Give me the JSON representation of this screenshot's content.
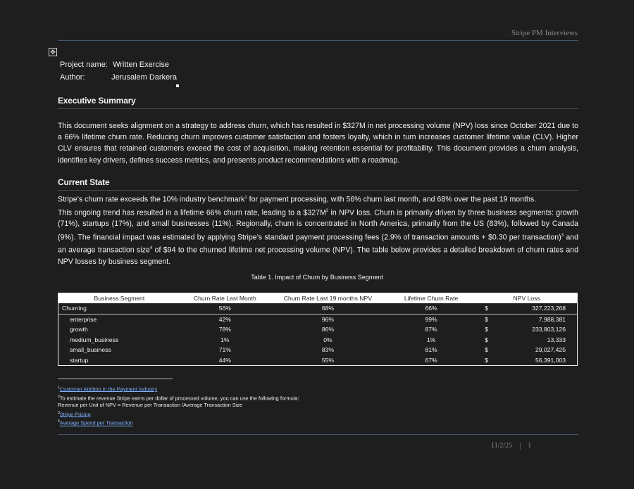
{
  "header": {
    "label": "Stripe PM Interviews"
  },
  "meta": {
    "project_label": "Project name:",
    "project_value": "Written Exercise",
    "author_label": "Author:",
    "author_value": "Jerusalem Darkera"
  },
  "sections": {
    "executive_summary": {
      "title": "Executive Summary",
      "body": "This document seeks alignment on a strategy to address churn, which has resulted in $327M in net processing volume (NPV) loss since October 2021 due to a 66% lifetime churn rate. Reducing churn improves customer satisfaction and fosters loyalty, which in turn increases customer lifetime value (CLV). Higher CLV ensures that retained customers exceed the cost of acquisition, making retention essential for profitability. This document provides a churn analysis, identifies key drivers, defines success metrics, and presents product recommendations with a roadmap."
    },
    "current_state": {
      "title": "Current State",
      "line1_a": "Stripe’s churn rate exceeds the 10% industry benchmark",
      "line1_sup": "1",
      "line1_b": " for payment processing, with 56% churn last month, and 68% over the past 19 months.",
      "body_a": "This ongoing trend has resulted in a lifetime 66% churn rate, leading to a $327M",
      "body_sup2": "2",
      "body_b": " in NPV loss. Churn is primarily driven by three business segments: growth (71%), startups (17%), and small businesses (11%). Regionally, churn is concentrated in North America, primarily from the US (83%), followed by Canada (9%). The financial impact was estimated by applying Stripe’s standard payment processing fees (2.9% of transaction amounts + $0.30 per transaction)",
      "body_sup3": "3",
      "body_c": " and an average transaction size",
      "body_sup4": "4",
      "body_d": " of $94 to the churned lifetime net processing volume (NPV). The table below provides a detailed breakdown of churn rates and NPV losses by business segment."
    }
  },
  "table": {
    "caption": "Table 1. Impact of Churn by Business Segment",
    "headers": [
      "Business Segment",
      "Churn Rate Last Month",
      "Churn Rate Last 19 months NPV",
      "Lifetime Churn Rate",
      "NPV Loss"
    ],
    "group": {
      "segment": "Churning",
      "last_month": "56%",
      "last_19": "68%",
      "lifetime": "66%",
      "currency": "$",
      "npv": "327,223,268"
    },
    "rows": [
      {
        "segment": "enterprise",
        "last_month": "42%",
        "last_19": "96%",
        "lifetime": "99%",
        "currency": "$",
        "npv": "7,988,381"
      },
      {
        "segment": "growth",
        "last_month": "78%",
        "last_19": "86%",
        "lifetime": "87%",
        "currency": "$",
        "npv": "233,803,126"
      },
      {
        "segment": "medium_business",
        "last_month": "1%",
        "last_19": "0%",
        "lifetime": "1%",
        "currency": "$",
        "npv": "13,333"
      },
      {
        "segment": "small_business",
        "last_month": "71%",
        "last_19": "83%",
        "lifetime": "81%",
        "currency": "$",
        "npv": "29,027,425"
      },
      {
        "segment": "startup",
        "last_month": "44%",
        "last_19": "55%",
        "lifetime": "67%",
        "currency": "$",
        "npv": "56,391,003"
      }
    ]
  },
  "footnotes": {
    "f1_num": "1",
    "f1_link": "Customer Attrition in the Payment Industry",
    "f2_num": "2",
    "f2_text": "To estimate the revenue Stripe earns per dollar of processed volume, you can use the following formula:",
    "f2_formula": "Revenue per Unit of NPV = Revenue per Transaction /Average Transaction Size",
    "f3_num": "3",
    "f3_link": "Stripe Pricing",
    "f4_num": "4",
    "f4_link": "Average Spend per Transaction"
  },
  "footer": {
    "date": "11/2/25",
    "separator": "|",
    "page": "1"
  }
}
